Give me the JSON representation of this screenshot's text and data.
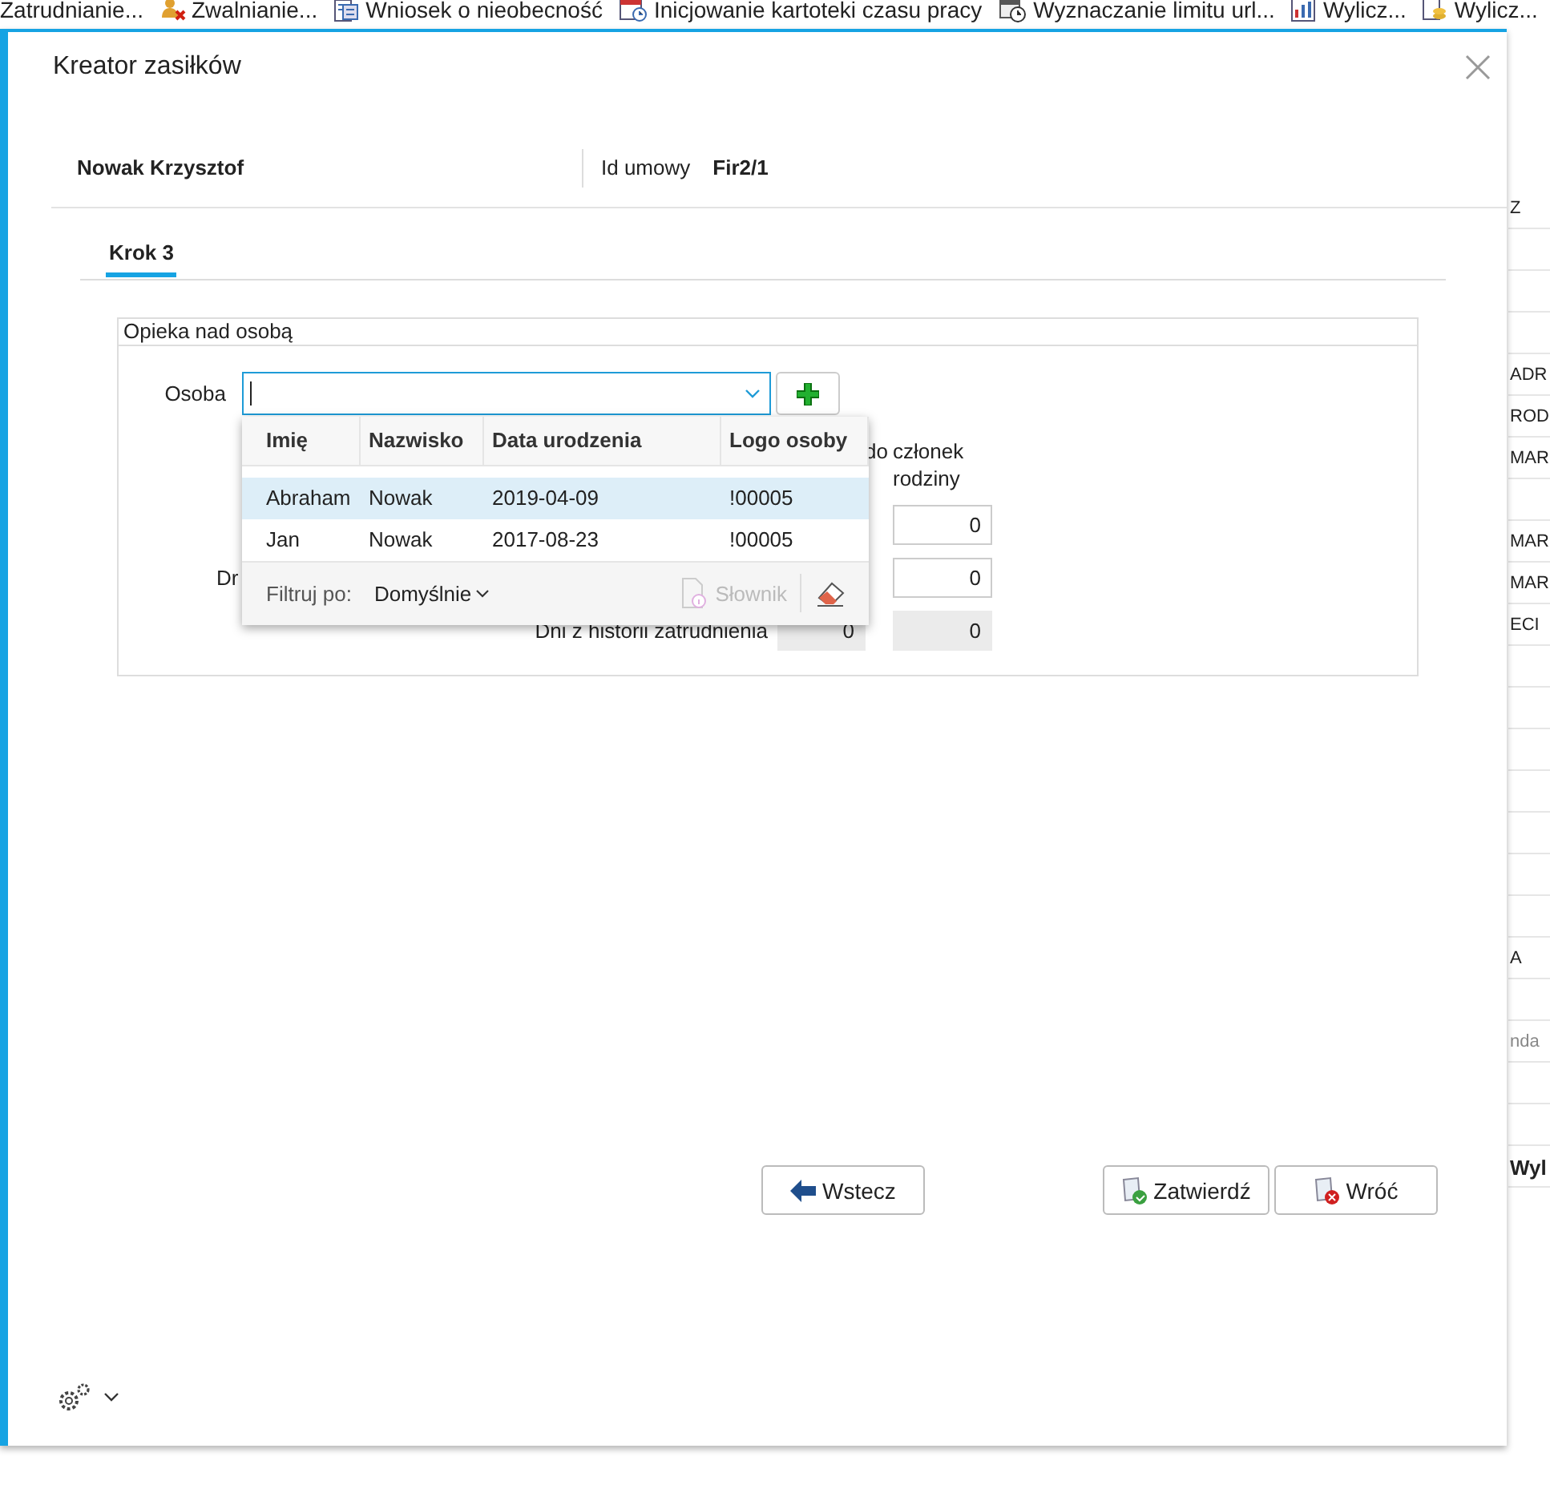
{
  "toolbar": {
    "items": [
      {
        "label": "Zatrudnianie...",
        "kind": "plain"
      },
      {
        "label": "Zwalnianie...",
        "kind": "remove-user"
      },
      {
        "label": "Wniosek o nieobecność",
        "kind": "form"
      },
      {
        "label": "Inicjowanie kartoteki czasu pracy",
        "kind": "calendar"
      },
      {
        "label": "Wyznaczanie limitu url...",
        "kind": "clock"
      },
      {
        "label": "Wylicz...",
        "kind": "chart"
      },
      {
        "label": "Wylicz...",
        "kind": "coins"
      }
    ]
  },
  "background_table": {
    "rows": [
      {
        "text": "Z",
        "kind": "cell"
      },
      {},
      {},
      {},
      {
        "text": "ADR",
        "kind": "cell"
      },
      {
        "text": "ROD",
        "kind": "cell"
      },
      {
        "text": "MAR",
        "kind": "cell"
      },
      {},
      {
        "text": "MAR",
        "kind": "cell"
      },
      {
        "text": "MAR",
        "kind": "cell"
      },
      {
        "text": "ECI",
        "kind": "cell"
      },
      {},
      {},
      {},
      {},
      {},
      {},
      {},
      {
        "text": "A",
        "kind": "cell"
      },
      {},
      {
        "text": "nda",
        "kind": "muted"
      },
      {},
      {},
      {
        "text": "Wyl",
        "kind": "strong"
      }
    ]
  },
  "dialog": {
    "title": "Kreator zasiłków",
    "header": {
      "name": "Nowak Krzysztof",
      "contract_label": "Id umowy",
      "contract_value": "Fir2/1"
    },
    "tabs": [
      {
        "label": "Krok 3",
        "selected": true
      }
    ],
    "group": {
      "title": "Opieka nad osobą",
      "person": {
        "label": "Osoba",
        "expanded": true,
        "popup": {
          "columns": [
            "Imię",
            "Nazwisko",
            "Data urodzenia",
            "Logo osoby"
          ],
          "rows": [
            {
              "cells": [
                "Abraham",
                "Nowak",
                "2019-04-09",
                "!00005"
              ],
              "selected": true
            },
            {
              "cells": [
                "Jan",
                "Nowak",
                "2017-08-23",
                "!00005"
              ],
              "selected": false
            }
          ],
          "filter_label": "Filtruj po:",
          "filter_value": "Domyślnie",
          "dictionary": {
            "label": "Słownik",
            "disabled": true
          }
        }
      },
      "grid": {
        "column_headers": [
          "do",
          "członek rodziny"
        ],
        "rows": [
          {
            "fields": [
              {
                "value": "0",
                "readonly": false
              }
            ]
          },
          {
            "label": "Dr",
            "covered": true,
            "fields": [
              {
                "value": "0",
                "readonly": false
              }
            ]
          },
          {
            "label": "Dni z historii zatrudnienia",
            "covered": false,
            "fields": [
              {
                "value": "0",
                "readonly": true
              },
              {
                "value": "0",
                "readonly": true
              }
            ]
          }
        ]
      }
    },
    "buttons": [
      {
        "label": "Wstecz",
        "kind": "back"
      },
      {
        "label": "Zatwierdź",
        "kind": "confirm"
      },
      {
        "label": "Wróć",
        "kind": "cancel"
      }
    ]
  }
}
